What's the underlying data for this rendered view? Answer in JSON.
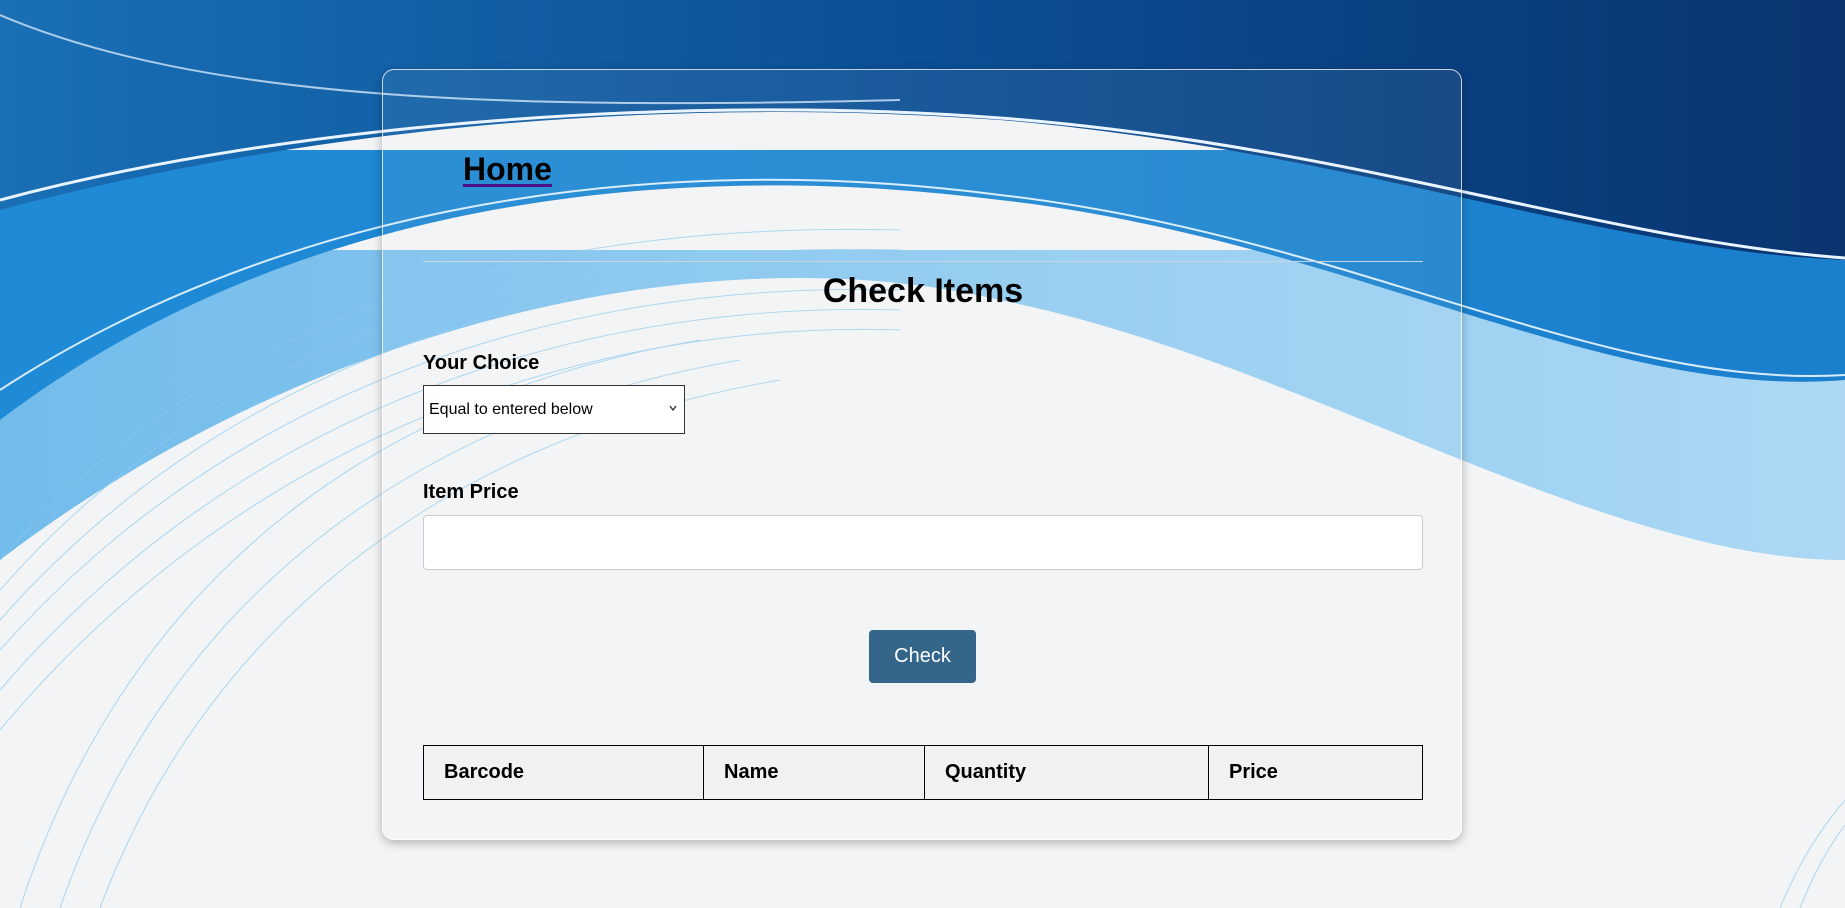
{
  "nav": {
    "home_label": "Home"
  },
  "page": {
    "title": "Check Items"
  },
  "form": {
    "choice_label": "Your Choice",
    "choice_selected": "Equal to entered below",
    "price_label": "Item Price",
    "price_value": "",
    "check_button_label": "Check"
  },
  "table": {
    "headers": [
      "Barcode",
      "Name",
      "Quantity",
      "Price"
    ],
    "rows": []
  },
  "colors": {
    "button": "#336688",
    "background_dark_blue": "#0a3f7a",
    "background_light_blue": "#8cc8ef"
  },
  "icons": {
    "select_arrow": "chevron-down-icon"
  }
}
